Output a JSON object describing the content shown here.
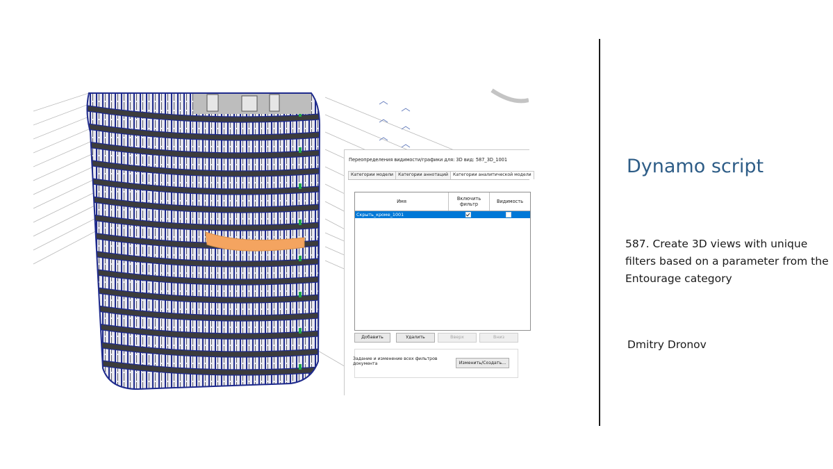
{
  "dialog": {
    "title": "Переопределения видимости/графики для: 3D вид: 587_3D_1001",
    "tabs": [
      "Категории модели",
      "Категории аннотаций",
      "Категории аналитической модели"
    ],
    "columns": {
      "name": "Имя",
      "enable_filter": "Включить\nфильтр",
      "visibility": "Видимость"
    },
    "rows": [
      {
        "name": "Скрыть_кроме_1001",
        "enable_filter": true,
        "visibility": false
      }
    ],
    "buttons": {
      "add": "Добавить",
      "delete": "Удалить",
      "up": "Вверх",
      "down": "Вниз"
    },
    "filters_note": "Задание и изменение всех фильтров документа",
    "edit_button": "Изменить/Создать..."
  },
  "side": {
    "heading": "Dynamo script",
    "description": "587. Create 3D views with unique filters based on a parameter from the Entourage category",
    "author": "Dmitry Dronov"
  },
  "colors": {
    "heading": "#2e5d87",
    "selection": "#0078d7",
    "highlight_floor": "#f4a460",
    "facade": "#1e2a8c"
  }
}
